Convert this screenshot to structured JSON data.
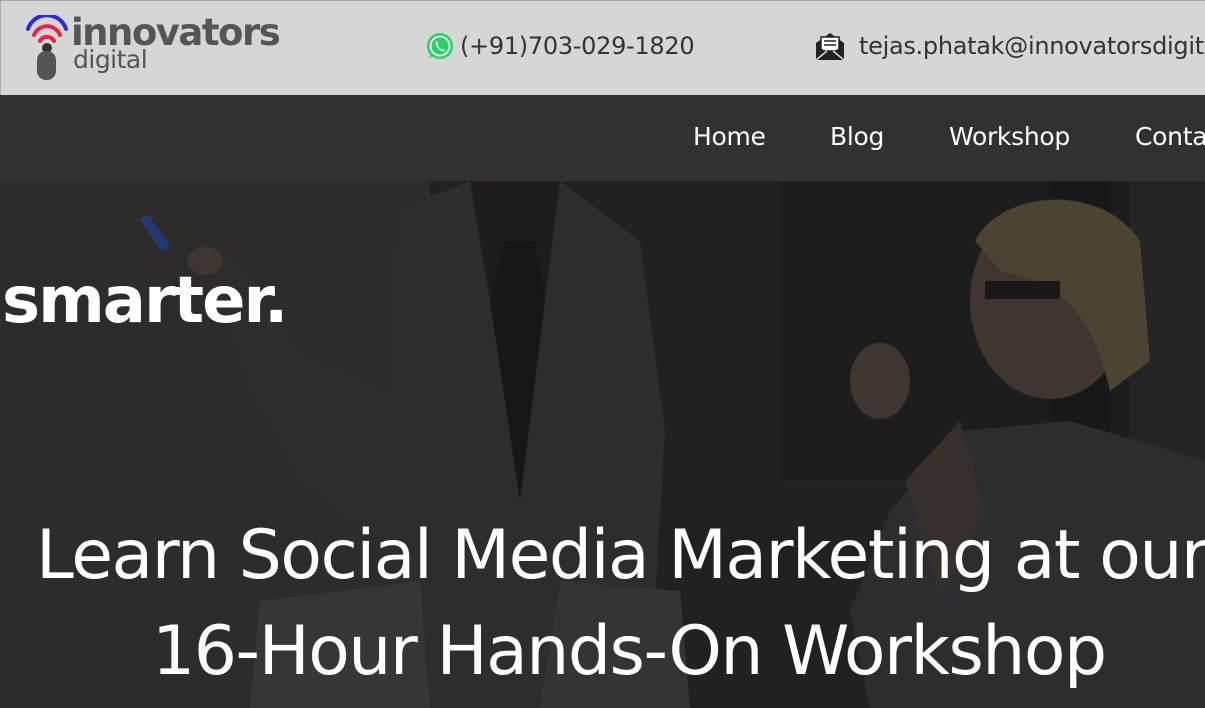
{
  "brand": {
    "name_line1": "innovators",
    "name_line2": "digital",
    "icon": "wifi-signal-logo-icon",
    "colors": {
      "signal_blue": "#2b2bd8",
      "signal_red": "#e8234a",
      "body_gray": "#555555"
    }
  },
  "contact": {
    "phone": "(+91)703-029-1820",
    "phone_icon": "whatsapp-icon",
    "email": "tejas.phatak@innovatorsdigital.in",
    "email_icon": "envelope-icon"
  },
  "nav": {
    "items": [
      {
        "label": "Home"
      },
      {
        "label": "Blog"
      },
      {
        "label": "Workshop"
      },
      {
        "label": "Contact"
      }
    ]
  },
  "hero": {
    "rotating_word": "smarter.",
    "headline_line1": "Learn Social Media Marketing at our",
    "headline_line2": "16-Hour Hands-On Workshop"
  },
  "colors": {
    "topbar_bg": "#d6d6d6",
    "navbar_bg": "#313131",
    "hero_overlay": "#1f1f1f",
    "whatsapp_green": "#25d366"
  }
}
